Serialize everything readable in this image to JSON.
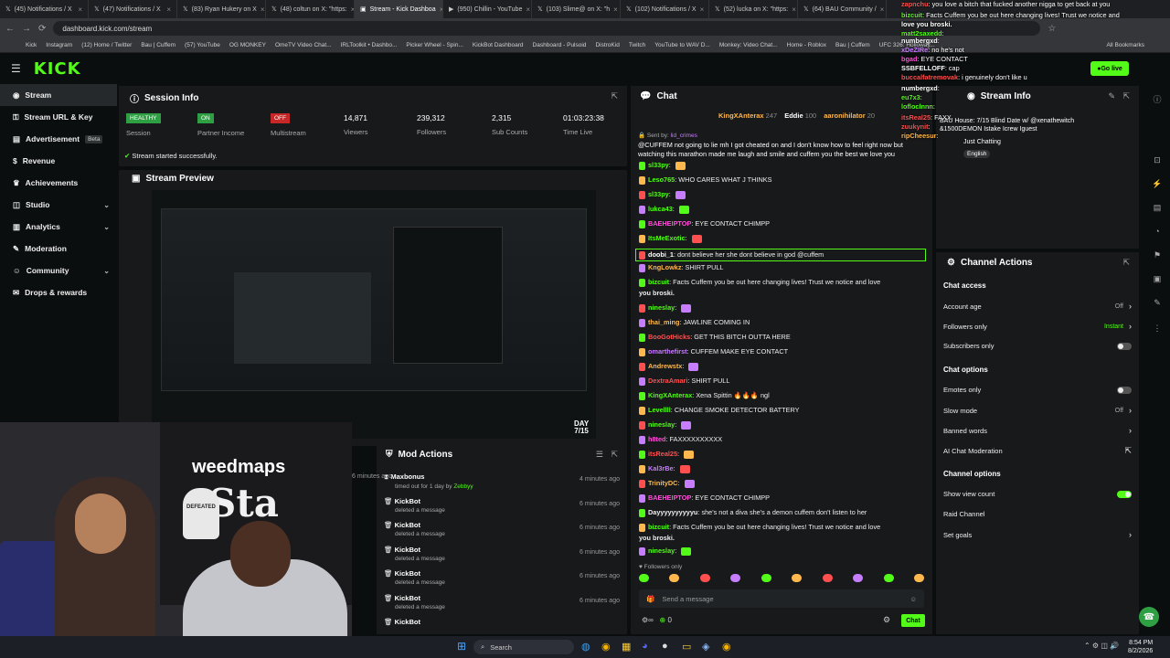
{
  "browser": {
    "tabs": [
      "(45) Notifications / X",
      "(47) Notifications / X",
      "(83) Ryan Hukery on X",
      "(48) coltun on X: \"https:",
      "Stream - Kick Dashboa",
      "(950) Chillin - YouTube",
      "(103) Slime@ on X: \"h",
      "(102) Notifications / X",
      "(52) lucka on X: \"https:",
      "(64) BAU Community /"
    ],
    "url": "dashboard.kick.com/stream",
    "bookmarks": [
      "Kick",
      "Instagram",
      "(12) Home / Twitter",
      "Bau | Cuffem",
      "(57) YouTube",
      "OG MONKEY",
      "OmeTV Video Chat...",
      "IRLToolkit • Dashbo...",
      "Picker Wheel - Spin...",
      "KickBot Dashboard",
      "Dashboard - Pulsoid",
      "DistroKid",
      "Twitch",
      "YouTube to WAV D...",
      "Monkey: Video Chat...",
      "Home - Roblox",
      "Bau | Cuffem",
      "UFC 326: Holloway...",
      "All Bookmarks"
    ]
  },
  "kick": {
    "logo": "KICK",
    "go_live": "Go live"
  },
  "sidebar": {
    "items": [
      {
        "label": "Stream",
        "icon": "stream-icon"
      },
      {
        "label": "Stream URL & Key",
        "icon": "key-icon"
      },
      {
        "label": "Advertisement",
        "icon": "ad-icon",
        "badge": "Beta"
      },
      {
        "label": "Revenue",
        "icon": "dollar-icon"
      },
      {
        "label": "Achievements",
        "icon": "trophy-icon"
      },
      {
        "label": "Studio",
        "icon": "studio-icon"
      },
      {
        "label": "Analytics",
        "icon": "chart-icon"
      },
      {
        "label": "Moderation",
        "icon": "wrench-icon"
      },
      {
        "label": "Community",
        "icon": "community-icon"
      },
      {
        "label": "Drops & rewards",
        "icon": "gift-icon"
      }
    ]
  },
  "session": {
    "title": "Session Info",
    "stats": [
      {
        "value": "HEALTHY",
        "label": "Session",
        "kind": "badge",
        "color": "#2ea043"
      },
      {
        "value": "ON",
        "label": "Partner Income",
        "kind": "badge",
        "color": "#2ea043"
      },
      {
        "value": "OFF",
        "label": "Multistream",
        "kind": "badge",
        "color": "#c62828"
      },
      {
        "value": "14,871",
        "label": "Viewers"
      },
      {
        "value": "239,312",
        "label": "Followers"
      },
      {
        "value": "2,315",
        "label": "Sub Counts"
      },
      {
        "value": "01:03:23:38",
        "label": "Time Live"
      }
    ],
    "status": "Stream started successfully."
  },
  "preview": {
    "title": "Stream Preview",
    "overlay": "DAY\n7/15"
  },
  "cam": {
    "banner": "weedmaps",
    "sign": "Sta",
    "hat": "DEFEATED"
  },
  "mod": {
    "title": "Mod Actions",
    "rows": [
      {
        "user": "Maxbonus",
        "detail": "timed out for 1 day by",
        "by": "Zebbyy",
        "time": "4 minutes ago"
      },
      {
        "user": "KickBot",
        "detail": "deleted a message",
        "time": "6 minutes ago"
      },
      {
        "user": "KickBot",
        "detail": "deleted a message",
        "time": "6 minutes ago"
      },
      {
        "user": "KickBot",
        "detail": "deleted a message",
        "time": "6 minutes ago"
      },
      {
        "user": "KickBot",
        "detail": "deleted a message",
        "time": "6 minutes ago"
      },
      {
        "user": "KickBot",
        "detail": "deleted a message",
        "time": "6 minutes ago"
      },
      {
        "user": "KickBot",
        "detail": "",
        "time": ""
      }
    ],
    "extra_time": "6 minutes ago"
  },
  "chat": {
    "title": "Chat",
    "top_gifters": [
      {
        "name": "KingXAnterax",
        "n": "247"
      },
      {
        "name": "Eddie",
        "n": "100"
      },
      {
        "name": "aaronihilator",
        "n": "20"
      }
    ],
    "sent_by": "Sent by",
    "sent_by_user": "lid_crimes",
    "pinned": "@CUFFEM not going to lie mh I got cheated on and I don't know how to feel right now but watching this marathon made me laugh and smile and cuffem you the best we love you",
    "messages": [
      {
        "user": "sl33py",
        "color": "#53fc18",
        "text": ""
      },
      {
        "user": "Leso765",
        "color": "#53fc18",
        "text": "WHO CARES WHAT J THINKS"
      },
      {
        "user": "sl33py",
        "color": "#53fc18",
        "text": ""
      },
      {
        "user": "lukca43",
        "color": "#53fc18",
        "text": ""
      },
      {
        "user": "BAEHEIPTOP",
        "color": "#ff4fd8",
        "text": "EYE CONTACT CHIMPP"
      },
      {
        "user": "ItsMeExotic",
        "color": "#53fc18",
        "text": ""
      },
      {
        "user": "doobi_1",
        "color": "#fff",
        "text": "dont believe her she dont believe in god @cuffem"
      },
      {
        "user": "KngLowkz",
        "color": "#ffb84d",
        "text": "SHIRT PULL"
      },
      {
        "user": "bizcuit",
        "color": "#53fc18",
        "text": "Facts Cuffem you be out here changing lives! Trust we notice and love"
      },
      {
        "user": "you broski.",
        "color": "#eee",
        "text": ""
      },
      {
        "user": "nineslay",
        "color": "#53fc18",
        "text": ""
      },
      {
        "user": "thai_ming",
        "color": "#ffb84d",
        "text": "JAWLINE COMING IN"
      },
      {
        "user": "BooGotHicks",
        "color": "#ff4f4f",
        "text": "GET THIS BITCH OUTTA HERE"
      },
      {
        "user": "omarthefirst",
        "color": "#c77dff",
        "text": "CUFFEM MAKE EYE CONTACT"
      },
      {
        "user": "Andrewstx",
        "color": "#ffb84d",
        "text": ""
      },
      {
        "user": "DextraAmari",
        "color": "#ff4f4f",
        "text": "SHIRT PULL"
      },
      {
        "user": "KingXAnterax",
        "color": "#53fc18",
        "text": "Xena Spittin 🔥🔥🔥 ngl"
      },
      {
        "user": "Levellll",
        "color": "#53fc18",
        "text": "CHANGE SMOKE DETECTOR BATTERY"
      },
      {
        "user": "nineslay",
        "color": "#53fc18",
        "text": ""
      },
      {
        "user": "h8ted",
        "color": "#ff4fd8",
        "text": "FAXXXXXXXXXX"
      },
      {
        "user": "itsReal25",
        "color": "#ff4f4f",
        "text": ""
      },
      {
        "user": "Kal3rBe",
        "color": "#c77dff",
        "text": ""
      },
      {
        "user": "TrinityDC",
        "color": "#ffb84d",
        "text": ""
      },
      {
        "user": "BAEHEIPTOP",
        "color": "#ff4fd8",
        "text": "EYE CONTACT CHIMPP"
      },
      {
        "user": "Dayyyyyyyyyyu",
        "color": "#eee",
        "text": "she's not a diva she's a demon cuffem don't listen to her"
      },
      {
        "user": "bizcuit",
        "color": "#53fc18",
        "text": "Facts Cuffem you be out here changing lives! Trust we notice and love"
      },
      {
        "user": "you broski.",
        "color": "#eee",
        "text": ""
      },
      {
        "user": "nineslay",
        "color": "#53fc18",
        "text": ""
      }
    ],
    "followers_only": "Followers only",
    "placeholder": "Send a message",
    "count": "0",
    "send": "Chat"
  },
  "stream_info": {
    "title": "Stream Info",
    "category": "Just Chatting",
    "language": "English",
    "titles": [
      "BAU House: 7/15 Blind Date w/ @xenathewitch",
      "&1500DEMON Istake Icrew Iguest"
    ]
  },
  "channel": {
    "title": "Channel Actions",
    "sections": [
      {
        "h": "Chat access",
        "rows": [
          {
            "label": "Account age",
            "value": "Off",
            "type": "chev"
          },
          {
            "label": "Followers only",
            "value": "Instant",
            "type": "chev",
            "accent": true
          },
          {
            "label": "Subscribers only",
            "type": "toggle",
            "on": false
          }
        ]
      },
      {
        "h": "Chat options",
        "rows": [
          {
            "label": "Emotes only",
            "type": "toggle",
            "on": false
          },
          {
            "label": "Slow mode",
            "value": "Off",
            "type": "chev"
          },
          {
            "label": "Banned words",
            "type": "chev"
          },
          {
            "label": "AI Chat Moderation",
            "type": "ext"
          }
        ]
      },
      {
        "h": "Channel options",
        "rows": [
          {
            "label": "Show view count",
            "type": "toggle",
            "on": true
          },
          {
            "label": "Raid Channel",
            "type": "none"
          },
          {
            "label": "Set goals",
            "type": "chev"
          }
        ]
      }
    ]
  },
  "overlay_chat": [
    {
      "user": "zapnchu",
      "color": "#ff4f4f",
      "text": "you love a bitch that fucked another nigga to get back at you"
    },
    {
      "user": "bizcuit",
      "color": "#53fc18",
      "text": "Facts Cuffem you be out here changing lives! Trust we notice and"
    },
    {
      "user": "love you broski.",
      "color": "#fff",
      "text": ""
    },
    {
      "user": "matt2saxedd",
      "color": "#53fc18",
      "text": ""
    },
    {
      "user": "numbergxd",
      "color": "#fff",
      "text": ""
    },
    {
      "user": "xDeZIRe",
      "color": "#c77dff",
      "text": "no he's not"
    },
    {
      "user": "bgad",
      "color": "#ff4fd8",
      "text": "EYE CONTACT"
    },
    {
      "user": "SSBFELLOFF",
      "color": "#fff",
      "text": "cap"
    },
    {
      "user": "buccalfatremovak",
      "color": "#ff4f4f",
      "text": "i genuinely don't like u"
    },
    {
      "user": "numbergxd",
      "color": "#fff",
      "text": ""
    },
    {
      "user": "eu7x3",
      "color": "#53fc18",
      "text": ""
    },
    {
      "user": "lofloclnnn",
      "color": "#53fc18",
      "text": ""
    },
    {
      "user": "itsReal25",
      "color": "#ff4f4f",
      "text": "FAXX"
    },
    {
      "user": "zuukynit",
      "color": "#ff4f4f",
      "text": ""
    },
    {
      "user": "ripCheesur",
      "color": "#ffb84d",
      "text": ""
    }
  ],
  "taskbar": {
    "search": "Search",
    "time": "8:54 PM",
    "date": "8/2/2026"
  },
  "colors": {
    "accent": "#53fc18",
    "panel": "#18191b",
    "bg": "#0b0e0f"
  }
}
